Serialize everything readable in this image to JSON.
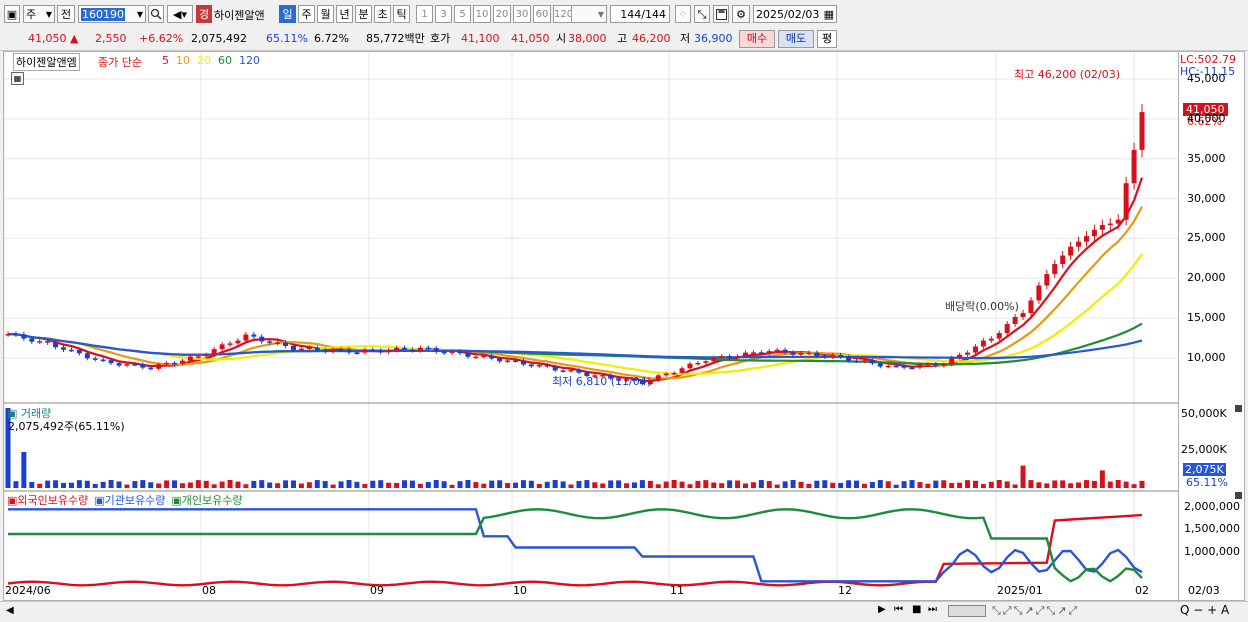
{
  "toolbar": {
    "period_type": "주",
    "range_label": "전",
    "code": "160190",
    "badge": "경",
    "stock_name": "하이젠알앤",
    "periods": [
      "일",
      "주",
      "월",
      "년",
      "분",
      "초",
      "틱"
    ],
    "active_period": "일",
    "intervals": [
      "1",
      "3",
      "5",
      "10",
      "20",
      "30",
      "60",
      "120"
    ],
    "count": "144",
    "count_total": "/144",
    "date": "2025/02/03"
  },
  "quote": {
    "price": "41,050",
    "arrow": "▲",
    "change": "2,550",
    "change_pct": "+6.62%",
    "volume": "2,075,492",
    "volume_ratio": "65.11%",
    "turnover": "6.72%",
    "amount": "85,772백만",
    "hoga_label": "호가",
    "ask": "41,100",
    "bid": "41,050",
    "open_label": "시",
    "open": "38,000",
    "high_label": "고",
    "high": "46,200",
    "low_label": "저",
    "low": "36,900",
    "buy": "매수",
    "sell": "매도",
    "eval": "평"
  },
  "price_panel": {
    "legend_name": "하이젠알앤엠",
    "legend_ma": "종가 단순",
    "ma_periods": [
      {
        "label": "5",
        "color": "#d8101c"
      },
      {
        "label": "10",
        "color": "#e69a14"
      },
      {
        "label": "20",
        "color": "#f2ee00"
      },
      {
        "label": "60",
        "color": "#1e8c3a"
      },
      {
        "label": "120",
        "color": "#2a55d8"
      }
    ],
    "high_note": "최고 46,200 (02/03)",
    "low_note": "최저 6,810 (11/04)",
    "dividend_note": "배당락(0.00%)",
    "lc": "LC:502.79",
    "hc": "HC:-11.15",
    "current_tag": "41,050",
    "current_pct": "6.62%",
    "yticks": [
      "45,000",
      "40,000",
      "35,000",
      "30,000",
      "25,000",
      "20,000",
      "15,000",
      "10,000"
    ]
  },
  "volume_panel": {
    "title": "거래량",
    "value": "2,075,492주(65.11%)",
    "yticks": [
      "50,000K",
      "25,000K"
    ],
    "current_tag": "2,075K",
    "current_pct": "65.11%"
  },
  "holding_panel": {
    "legends": [
      {
        "label": "외국인보유수량",
        "color": "#d8101c"
      },
      {
        "label": "기관보유수량",
        "color": "#2a55d8"
      },
      {
        "label": "개인보유수량",
        "color": "#1e8c3a"
      }
    ],
    "yticks": [
      "2,000,000",
      "1,500,000",
      "1,000,000"
    ]
  },
  "xaxis": [
    "2024/06",
    "08",
    "09",
    "10",
    "11",
    "12",
    "2025/01",
    "02"
  ],
  "xaxis_right": "02/03",
  "colors": {
    "up": "#d8101c",
    "down": "#1a3fd0",
    "active": "#2a6bd6"
  }
}
